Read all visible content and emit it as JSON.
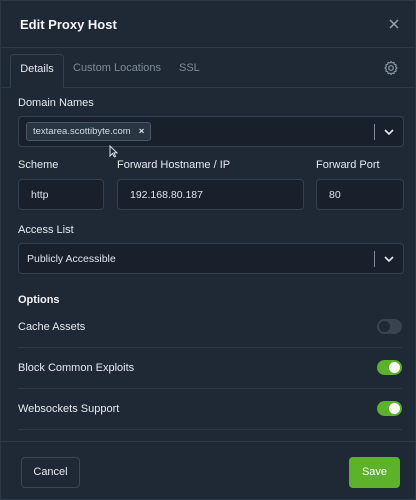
{
  "header": {
    "title": "Edit Proxy Host",
    "close_icon": "close-icon"
  },
  "tabs": [
    {
      "label": "Details",
      "active": true
    },
    {
      "label": "Custom Locations",
      "active": false
    },
    {
      "label": "SSL",
      "active": false
    }
  ],
  "domain_names": {
    "label": "Domain Names",
    "chips": [
      {
        "value": "textarea.scottibyte.com",
        "remove_symbol": "×"
      }
    ]
  },
  "scheme": {
    "label": "Scheme",
    "value": "http"
  },
  "forward_host": {
    "label": "Forward Hostname / IP",
    "value": "192.168.80.187"
  },
  "forward_port": {
    "label": "Forward Port",
    "value": "80"
  },
  "access_list": {
    "label": "Access List",
    "value": "Publicly Accessible"
  },
  "options": {
    "title": "Options",
    "items": [
      {
        "label": "Cache Assets",
        "enabled": false
      },
      {
        "label": "Block Common Exploits",
        "enabled": true
      },
      {
        "label": "Websockets Support",
        "enabled": true
      }
    ]
  },
  "footer": {
    "cancel_label": "Cancel",
    "save_label": "Save"
  },
  "colors": {
    "accent": "#5cb229",
    "background": "#1f2935",
    "input_bg": "#17202b"
  }
}
